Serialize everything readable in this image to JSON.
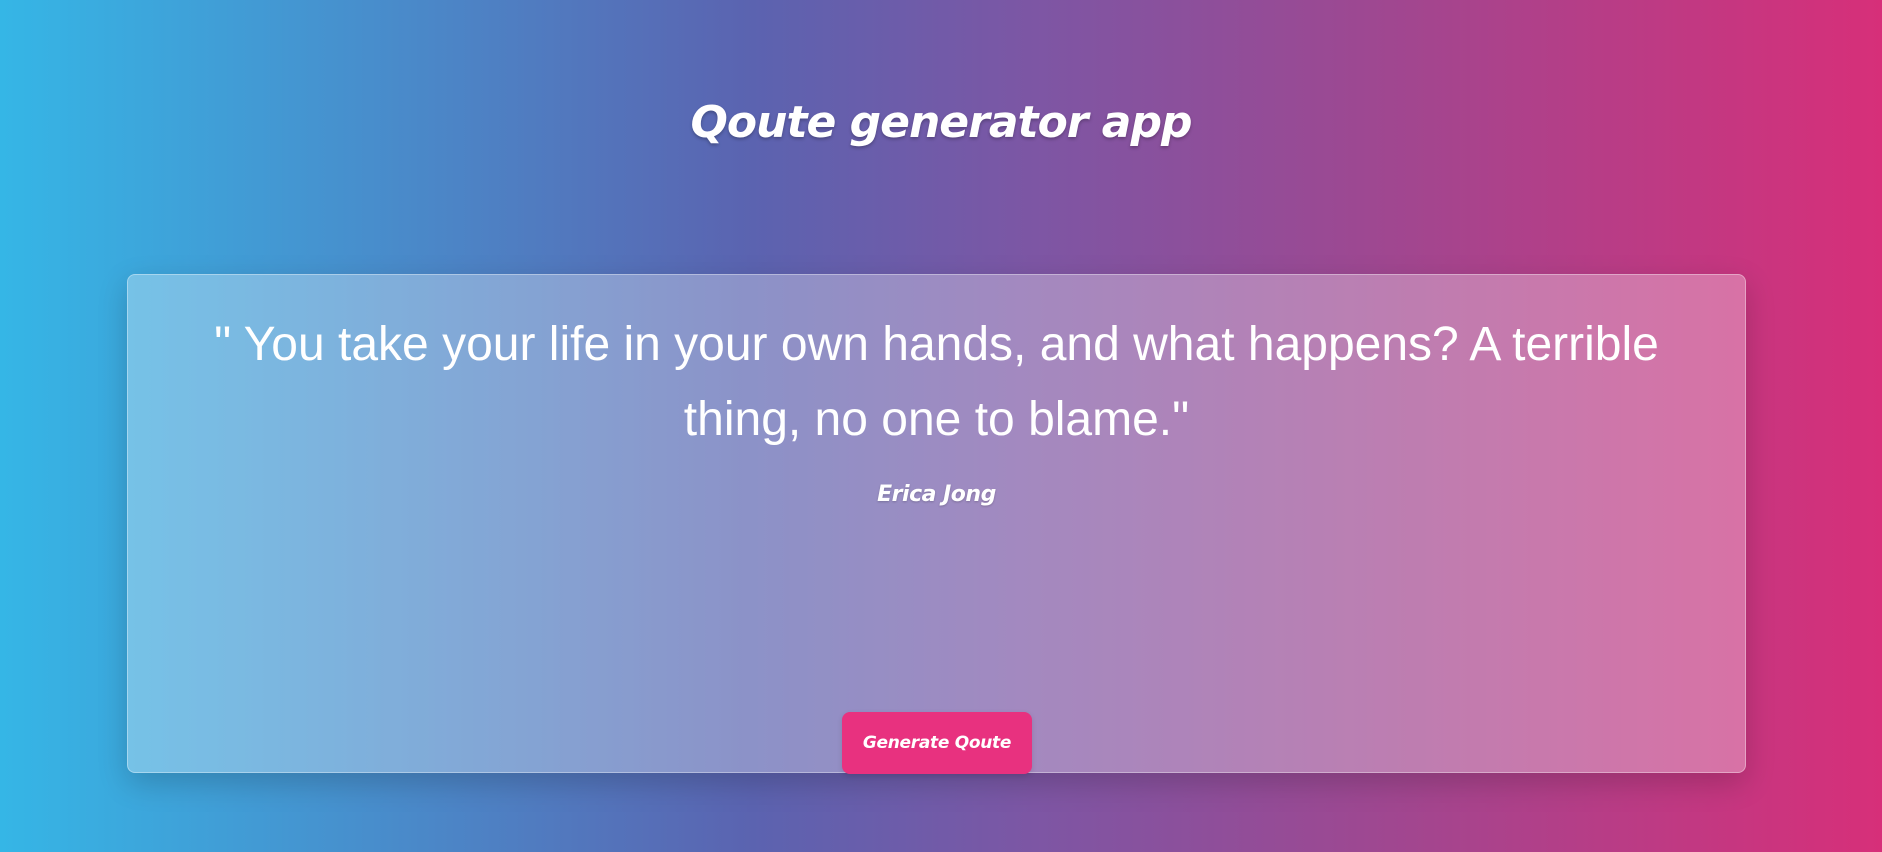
{
  "header": {
    "title": "Qoute generator app"
  },
  "quote": {
    "text": "\" You take your life in your own hands, and what happens? A terrible thing, no one to blame.\"",
    "author": "Erica Jong"
  },
  "actions": {
    "generate_label": "Generate Qoute"
  },
  "colors": {
    "gradient_start": "#35b6e6",
    "gradient_mid": "#5b63b0",
    "gradient_end": "#d72f79",
    "button": "#e8317f",
    "text": "#ffffff"
  }
}
